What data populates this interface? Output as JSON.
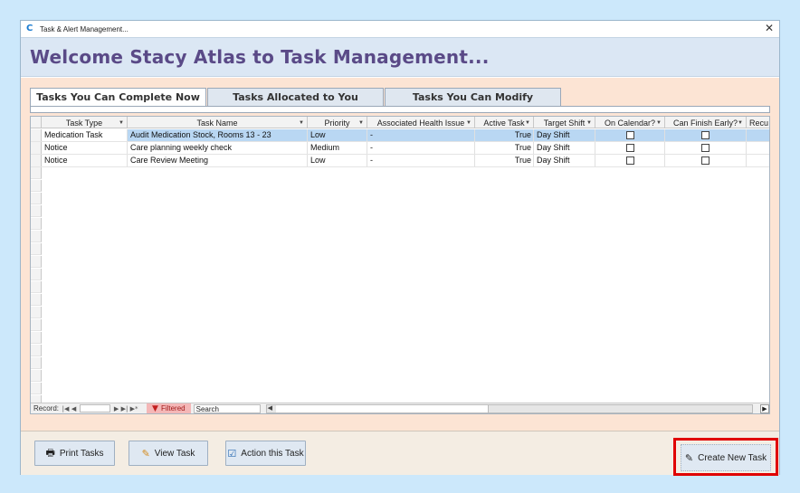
{
  "window": {
    "title": "Task & Alert Management...",
    "close_glyph": "✕",
    "app_icon": "C"
  },
  "header": {
    "welcome": "Welcome Stacy Atlas to Task Management..."
  },
  "tabs": [
    {
      "label": "Tasks You Can Complete Now",
      "active": true
    },
    {
      "label": "Tasks Allocated to You",
      "active": false
    },
    {
      "label": "Tasks You Can Modify",
      "active": false
    }
  ],
  "table": {
    "columns": [
      "Task Type",
      "Task Name",
      "Priority",
      "Associated Health Issue",
      "Active Task",
      "Target Shift",
      "On Calendar?",
      "Can Finish Early?",
      "Recu"
    ],
    "rows": [
      {
        "type": "Medication Task",
        "name": "Audit Medication Stock, Rooms 13 - 23",
        "priority": "Low",
        "health": "-",
        "active": "True",
        "shift": "Day Shift",
        "calendar": false,
        "early": false
      },
      {
        "type": "Notice",
        "name": "Care planning weekly check",
        "priority": "Medium",
        "health": "-",
        "active": "True",
        "shift": "Day Shift",
        "calendar": false,
        "early": false
      },
      {
        "type": "Notice",
        "name": "Care Review Meeting",
        "priority": "Low",
        "health": "-",
        "active": "True",
        "shift": "Day Shift",
        "calendar": false,
        "early": false
      }
    ]
  },
  "record_nav": {
    "label": "Record:",
    "first": "|◀",
    "prev": "◀",
    "next": "▶",
    "last": "▶|",
    "new": "▶*",
    "filtered": "Filtered",
    "search": "Search"
  },
  "buttons": {
    "print": "Print Tasks",
    "view": "View Task",
    "action": "Action this Task",
    "create": "Create New Task"
  },
  "colors": {
    "highlight": "#e00000",
    "title_purple": "#5a4a87"
  }
}
